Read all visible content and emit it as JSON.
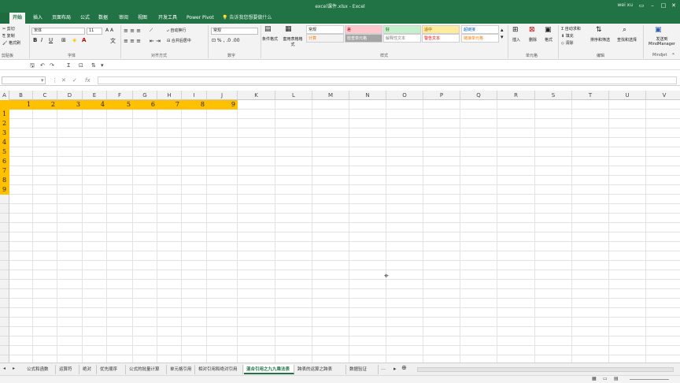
{
  "window": {
    "title": "excel课件.xlsx - Excel",
    "user": "wei xu"
  },
  "tabs": [
    "开始",
    "插入",
    "页面布局",
    "公式",
    "数据",
    "审阅",
    "视图",
    "开发工具",
    "Power Pivot"
  ],
  "active_tab": "开始",
  "tell_me": "告诉我您想要做什么",
  "ribbon": {
    "clipboard": {
      "cut": "剪切",
      "copy": "复制",
      "format_painter": "格式刷",
      "label": "剪贴板"
    },
    "font": {
      "name": "宋体",
      "size": "11",
      "label": "字体"
    },
    "alignment": {
      "wrap": "自动换行",
      "merge": "合并后居中",
      "label": "对齐方式"
    },
    "number": {
      "format": "常规",
      "label": "数字"
    },
    "styles": {
      "conditional": "条件格式",
      "table": "套用表格格式",
      "cells": [
        {
          "text": "常规",
          "bg": "#ffffff",
          "color": "#222222"
        },
        {
          "text": "差",
          "bg": "#ffc7ce",
          "color": "#9c0006"
        },
        {
          "text": "好",
          "bg": "#c6efce",
          "color": "#006100"
        },
        {
          "text": "适中",
          "bg": "#ffeb9c",
          "color": "#9c5700"
        },
        {
          "text": "超链接",
          "bg": "#ffffff",
          "color": "#0563c1"
        },
        {
          "text": "计算",
          "bg": "#f2f2f2",
          "color": "#fa7d00"
        },
        {
          "text": "检查单元格",
          "bg": "#a5a5a5",
          "color": "#ffffff"
        },
        {
          "text": "解释性文本",
          "bg": "#ffffff",
          "color": "#7f7f7f"
        },
        {
          "text": "警告文本",
          "bg": "#ffffff",
          "color": "#ff0000"
        },
        {
          "text": "链接单元格",
          "bg": "#ffffff",
          "color": "#fa7d00"
        }
      ],
      "label": "样式"
    },
    "cells_group": {
      "insert": "插入",
      "delete": "删除",
      "format": "格式",
      "label": "单元格"
    },
    "editing": {
      "autosum": "自动求和",
      "fill": "填充",
      "clear": "清除",
      "sort": "排序和筛选",
      "find": "查找和选择",
      "label": "编辑"
    },
    "mindjet": {
      "send": "发送到 MindManager",
      "label": "Mindjet"
    }
  },
  "columns": [
    "A",
    "B",
    "C",
    "D",
    "E",
    "F",
    "G",
    "H",
    "I",
    "J",
    "K",
    "L",
    "M",
    "N",
    "O",
    "P",
    "Q",
    "R",
    "S",
    "T",
    "U",
    "V"
  ],
  "row1_values": [
    "1",
    "2",
    "3",
    "4",
    "5",
    "6",
    "7",
    "8",
    "9"
  ],
  "col_a_values": [
    "1",
    "2",
    "3",
    "4",
    "5",
    "6",
    "7",
    "8",
    "9"
  ],
  "highlight_color": "#ffc000",
  "sheets": [
    "公式和函数",
    "运算符",
    "绝对",
    "优先顺序",
    "公式的批量计算",
    "单元格引用",
    "相对引用和绝对引用",
    "混合引用之九九乘法表",
    "跨表的运算之跨表",
    "数据验证"
  ],
  "active_sheet": "混合引用之九九乘法表"
}
